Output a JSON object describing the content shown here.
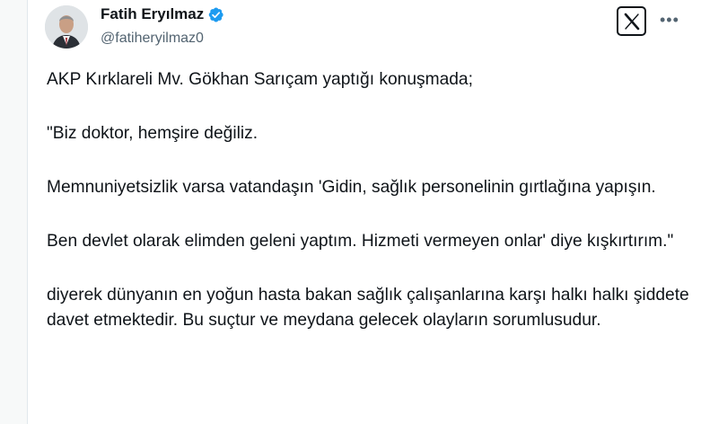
{
  "author": {
    "name": "Fatih Eryılmaz",
    "handle": "@fatiheryilmaz0",
    "verified": true
  },
  "colors": {
    "verified_badge": "#1d9bf0",
    "text": "#0f1419",
    "secondary_text": "#536471"
  },
  "icons": {
    "top_right": [
      "x-logo-icon",
      "more-options-icon"
    ]
  },
  "tweet": {
    "paragraphs": [
      "AKP Kırklareli Mv. Gökhan Sarıçam yaptığı konuşmada;",
      "\"Biz doktor, hemşire değiliz.",
      "Memnuniyetsizlik varsa vatandaşın 'Gidin, sağlık personelinin gırtlağına yapışın.",
      "Ben devlet olarak elimden geleni yaptım. Hizmeti vermeyen onlar' diye kışkırtırım.\"",
      "diyerek dünyanın en yoğun hasta bakan sağlık çalışanlarına karşı halkı halkı şiddete davet etmektedir. Bu suçtur ve meydana gelecek olayların sorumlusudur."
    ]
  }
}
